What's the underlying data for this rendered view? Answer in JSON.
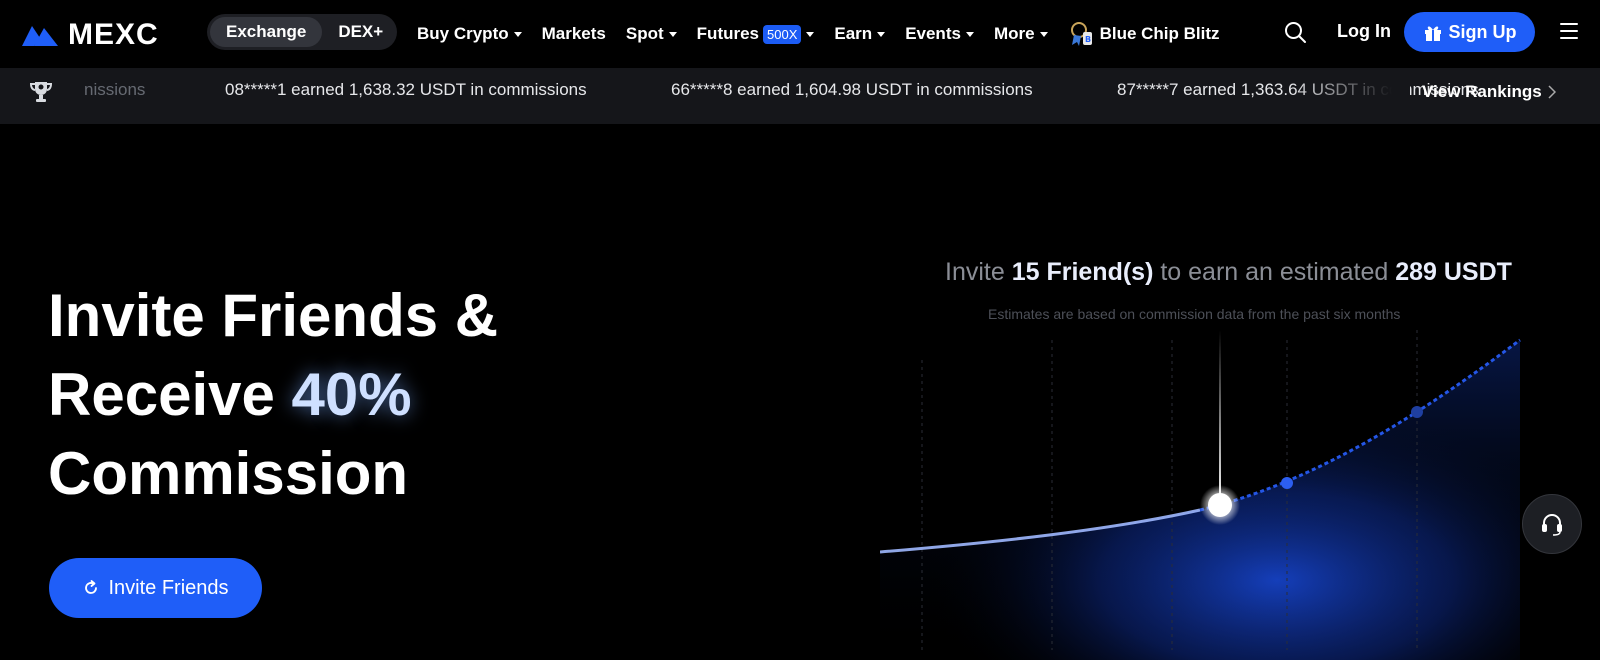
{
  "brand": {
    "name": "MEXC",
    "accent": "#1f5ef8"
  },
  "nav": {
    "modes": [
      "Exchange",
      "DEX+"
    ],
    "active_mode": "Exchange",
    "items": [
      {
        "label": "Buy Crypto",
        "dropdown": true
      },
      {
        "label": "Markets",
        "dropdown": false
      },
      {
        "label": "Spot",
        "dropdown": true
      },
      {
        "label": "Futures",
        "badge": "500X",
        "dropdown": true
      },
      {
        "label": "Earn",
        "dropdown": true
      },
      {
        "label": "Events",
        "dropdown": true
      },
      {
        "label": "More",
        "dropdown": true
      }
    ],
    "promo": {
      "label": "Blue Chip Blitz",
      "icon": "blitz-icon"
    },
    "login": "Log In",
    "signup": "Sign Up"
  },
  "ticker": {
    "partial_left": "nissions",
    "entries": [
      "08*****1 earned 1,638.32 USDT in commissions",
      "66*****8 earned 1,604.98 USDT in commissions",
      "87*****7 earned 1,363.64 USDT in commissions"
    ],
    "view_rankings": "View Rankings"
  },
  "hero": {
    "line1": "Invite Friends &",
    "line2_pre": "Receive ",
    "line2_accent": "40%",
    "line3": "Commission",
    "cta": "Invite Friends"
  },
  "estimate": {
    "prefix": "Invite ",
    "friends": "15 Friend(s)",
    "middle": " to earn an estimated ",
    "amount": "289 USDT",
    "note": "Estimates are based on commission data from the past six months"
  }
}
